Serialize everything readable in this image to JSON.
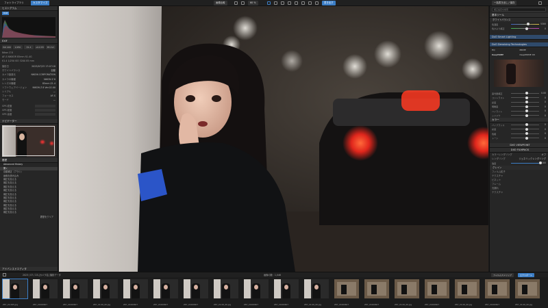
{
  "topbar": {
    "tab_library": "フォトライブラリ",
    "tab_customize": "カスタマイズ",
    "btn_compare": "画像比較",
    "zoom": "60 %",
    "btn_export": "書き出す",
    "btn_batch": "一括書き出し / 保存",
    "btn_settings": "環境設定"
  },
  "left": {
    "section_histogram": "ヒストグラム",
    "histogram_mode": "RGB",
    "section_info": "EXIF",
    "exposure_readout": "f/1.4  1/250  ISO 3200  85 mm",
    "info_buttons": [
      "ISO 400",
      "1/250",
      "f/1.4",
      "+0.0 EV",
      "85 mm"
    ],
    "camera_model": "Nikon Z 8",
    "lens": "AF-S NIKKOR 85mm f/1.4G",
    "metadata": [
      {
        "k": "撮影日",
        "v": "2023/07/23 17:07:18"
      },
      {
        "k": "ホワイトバランス",
        "v": "自動"
      },
      {
        "k": "カメラ製造元",
        "v": "NIKON CORPORATION"
      },
      {
        "k": "カメラの機種",
        "v": "NIKON Z 8"
      },
      {
        "k": "レンズの機種",
        "v": "85mm f/1.4"
      },
      {
        "k": "ソフトウェアバージョン",
        "v": "NIKON Z 8 Ver.02.00"
      },
      {
        "k": "シリアル",
        "v": "—"
      },
      {
        "k": "フォーカス",
        "v": "AF-S"
      },
      {
        "k": "モード",
        "v": "—"
      }
    ],
    "gps_rows": [
      {
        "k": "GPS 緯度",
        "v": ""
      },
      {
        "k": "GPS 経度",
        "v": ""
      },
      {
        "k": "GPS 高度",
        "v": ""
      }
    ],
    "section_navigator": "ナビゲーター",
    "section_history": "履歴",
    "history_header": "Advanced History",
    "history_items": [
      "開く",
      "自動補正（ブラシ）",
      "画像を読み込み",
      "補正を加える",
      "補正を加える",
      "補正を加える",
      "補正を加える",
      "補正を加える",
      "補正を加える",
      "補正を加える",
      "補正を加える",
      "補正を加える",
      "補正を加える"
    ],
    "history_footer": "履歴をクリア",
    "section_advanced": "アドバンスドエディタ"
  },
  "right": {
    "search_placeholder": "補正設定を検索",
    "section_basic": "基本ツール",
    "sub_whitebalance": "ホワイトバランス",
    "wb_rows": [
      {
        "label": "色温度",
        "value": "5300"
      },
      {
        "label": "色かぶり補正",
        "value": "0"
      }
    ],
    "section_lighting": "DxO Smart Lighting",
    "section_denoise": "DxO Denoising Technologies",
    "denoise_modes": [
      "HQ",
      "PRIME",
      "DeepPRIME",
      "DeepPRIME XD"
    ],
    "sliders_a": [
      {
        "label": "露光量補正",
        "value": "0.00"
      },
      {
        "label": "コントラスト",
        "value": "0"
      },
      {
        "label": "彩度",
        "value": "0"
      },
      {
        "label": "明瞭度",
        "value": "0"
      },
      {
        "label": "ハイライト",
        "value": "0"
      },
      {
        "label": "シャドウ",
        "value": "0"
      }
    ],
    "section_color": "カラー",
    "sliders_b": [
      {
        "label": "バイブランス",
        "value": "0"
      },
      {
        "label": "彩度",
        "value": "0"
      },
      {
        "label": "色相",
        "value": "0"
      },
      {
        "label": "トーン",
        "value": "0"
      }
    ],
    "section_viewpoint": "DXO VIEWPOINT",
    "section_filmpack": "DXO FILMPACK",
    "filmpack_rows": [
      {
        "label": "カラーレンダリング",
        "value": "オフ"
      },
      {
        "label": "レンダリング",
        "value": "ジェネリックレンダリング"
      },
      {
        "label": "強度",
        "value": "100"
      }
    ],
    "section_texture": "グレイン",
    "texture_items": [
      "フィルム粒子",
      "テクスチャ",
      "ビネット",
      "フレーム",
      "光漏れ",
      "テクスチャ"
    ]
  },
  "filmbar": {
    "path": "2023 / 07 / 23-[カメラ名] 撮影データ",
    "count": "画像の数：1,046",
    "btn_filmstrip": "フィルムストリップ",
    "btn_export": "エクスポート"
  },
  "filmstrip": [
    {
      "name": "Z87_22-065.jpg"
    },
    {
      "name": "Z87_22460607"
    },
    {
      "name": "Z87_22460607"
    },
    {
      "name": "Z87_22-06_06.jpg"
    },
    {
      "name": "Z87_22460607"
    },
    {
      "name": "Z87_22460607"
    },
    {
      "name": "Z87_22460607"
    },
    {
      "name": "Z87_22-06_06.jpg"
    },
    {
      "name": "Z87_22460607"
    },
    {
      "name": "Z87_22460607"
    },
    {
      "name": "Z87_22-06_06.jpg"
    },
    {
      "name": "Z87_22460607"
    },
    {
      "name": "Z87_22460607"
    },
    {
      "name": "Z87_22-06_06.jpg"
    },
    {
      "name": "Z87_22460607"
    },
    {
      "name": "Z87_22-06_06.jpg"
    },
    {
      "name": "Z87_22460607"
    },
    {
      "name": "Z87_22-06_06.jpg"
    }
  ],
  "colors": {
    "accent": "#3c7ec6",
    "panel": "#262626",
    "background": "#1a1a1a"
  }
}
